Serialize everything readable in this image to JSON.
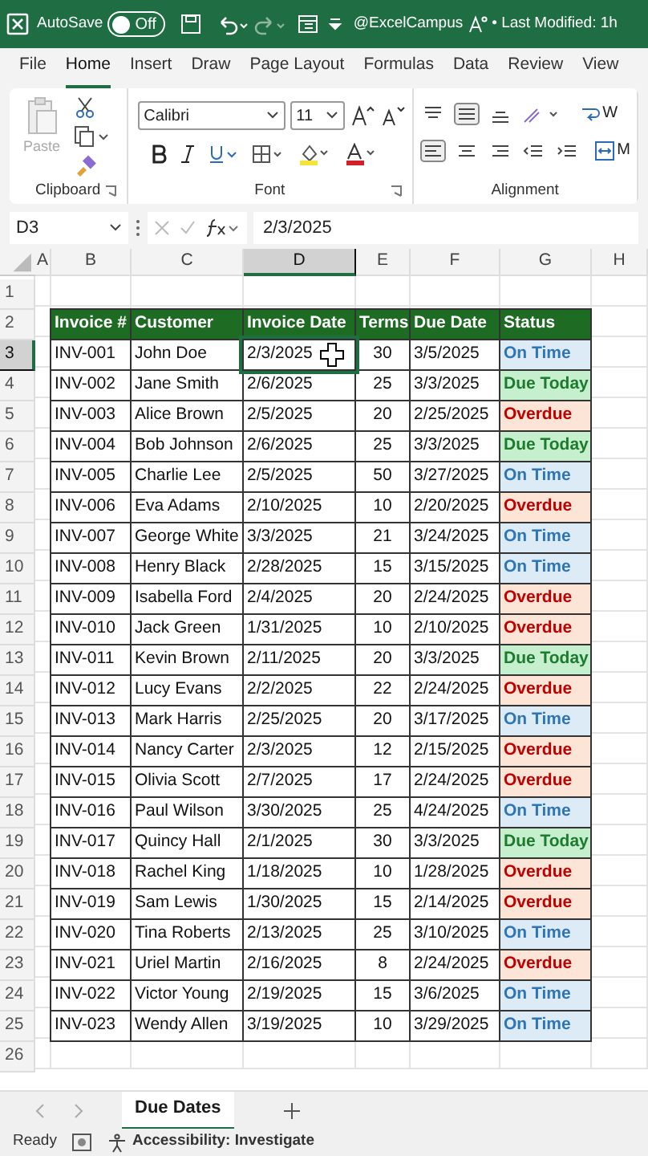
{
  "title_bar": {
    "autosave_label": "AutoSave",
    "autosave": {
      "on": false,
      "label": "Off"
    },
    "account": "@ExcelCampus",
    "modified": "• Last Modified: 1h"
  },
  "menu_tabs": [
    {
      "label": "File",
      "selected": false
    },
    {
      "label": "Home",
      "selected": true
    },
    {
      "label": "Insert",
      "selected": false
    },
    {
      "label": "Draw",
      "selected": false
    },
    {
      "label": "Page Layout",
      "selected": false
    },
    {
      "label": "Formulas",
      "selected": false
    },
    {
      "label": "Data",
      "selected": false
    },
    {
      "label": "Review",
      "selected": false
    },
    {
      "label": "View",
      "selected": false
    }
  ],
  "ribbon": {
    "paste_label": "Paste",
    "font_name": "Calibri",
    "font_size": "11",
    "wrap_text": "W",
    "merge": "M",
    "groups": [
      "Clipboard",
      "Font",
      "Alignment"
    ]
  },
  "formula_bar": {
    "name_box": "D3",
    "formula": "2/3/2025"
  },
  "columns": [
    {
      "label": "A",
      "selected": false
    },
    {
      "label": "B",
      "selected": false
    },
    {
      "label": "C",
      "selected": false
    },
    {
      "label": "D",
      "selected": true
    },
    {
      "label": "E",
      "selected": false
    },
    {
      "label": "F",
      "selected": false
    },
    {
      "label": "G",
      "selected": false
    },
    {
      "label": "H",
      "selected": false
    }
  ],
  "row_numbers": [
    {
      "label": "1",
      "selected": false
    },
    {
      "label": "2",
      "selected": false
    },
    {
      "label": "3",
      "selected": true
    },
    {
      "label": "4",
      "selected": false
    },
    {
      "label": "5",
      "selected": false
    },
    {
      "label": "6",
      "selected": false
    },
    {
      "label": "7",
      "selected": false
    },
    {
      "label": "8",
      "selected": false
    },
    {
      "label": "9",
      "selected": false
    },
    {
      "label": "10",
      "selected": false
    },
    {
      "label": "11",
      "selected": false
    },
    {
      "label": "12",
      "selected": false
    },
    {
      "label": "13",
      "selected": false
    },
    {
      "label": "14",
      "selected": false
    },
    {
      "label": "15",
      "selected": false
    },
    {
      "label": "16",
      "selected": false
    },
    {
      "label": "17",
      "selected": false
    },
    {
      "label": "18",
      "selected": false
    },
    {
      "label": "19",
      "selected": false
    },
    {
      "label": "20",
      "selected": false
    },
    {
      "label": "21",
      "selected": false
    },
    {
      "label": "22",
      "selected": false
    },
    {
      "label": "23",
      "selected": false
    },
    {
      "label": "24",
      "selected": false
    },
    {
      "label": "25",
      "selected": false
    },
    {
      "label": "26",
      "selected": false
    }
  ],
  "table": {
    "headers": [
      "Invoice #",
      "Customer",
      "Invoice Date",
      "Terms",
      "Due Date",
      "Status"
    ],
    "rows": [
      {
        "invoice": "INV-001",
        "customer": "John Doe",
        "invoice_date": "2/3/2025",
        "terms": "30",
        "due_date": "3/5/2025",
        "status": "On Time",
        "kind": "on_time",
        "selected": true
      },
      {
        "invoice": "INV-002",
        "customer": "Jane Smith",
        "invoice_date": "2/6/2025",
        "terms": "25",
        "due_date": "3/3/2025",
        "status": "Due Today",
        "kind": "due_today",
        "selected": false
      },
      {
        "invoice": "INV-003",
        "customer": "Alice Brown",
        "invoice_date": "2/5/2025",
        "terms": "20",
        "due_date": "2/25/2025",
        "status": "Overdue",
        "kind": "overdue",
        "selected": false
      },
      {
        "invoice": "INV-004",
        "customer": "Bob Johnson",
        "invoice_date": "2/6/2025",
        "terms": "25",
        "due_date": "3/3/2025",
        "status": "Due Today",
        "kind": "due_today",
        "selected": false
      },
      {
        "invoice": "INV-005",
        "customer": "Charlie Lee",
        "invoice_date": "2/5/2025",
        "terms": "50",
        "due_date": "3/27/2025",
        "status": "On Time",
        "kind": "on_time",
        "selected": false
      },
      {
        "invoice": "INV-006",
        "customer": "Eva Adams",
        "invoice_date": "2/10/2025",
        "terms": "10",
        "due_date": "2/20/2025",
        "status": "Overdue",
        "kind": "overdue",
        "selected": false
      },
      {
        "invoice": "INV-007",
        "customer": "George White",
        "invoice_date": "3/3/2025",
        "terms": "21",
        "due_date": "3/24/2025",
        "status": "On Time",
        "kind": "on_time",
        "selected": false
      },
      {
        "invoice": "INV-008",
        "customer": "Henry Black",
        "invoice_date": "2/28/2025",
        "terms": "15",
        "due_date": "3/15/2025",
        "status": "On Time",
        "kind": "on_time",
        "selected": false
      },
      {
        "invoice": "INV-009",
        "customer": "Isabella Ford",
        "invoice_date": "2/4/2025",
        "terms": "20",
        "due_date": "2/24/2025",
        "status": "Overdue",
        "kind": "overdue",
        "selected": false
      },
      {
        "invoice": "INV-010",
        "customer": "Jack Green",
        "invoice_date": "1/31/2025",
        "terms": "10",
        "due_date": "2/10/2025",
        "status": "Overdue",
        "kind": "overdue",
        "selected": false
      },
      {
        "invoice": "INV-011",
        "customer": "Kevin Brown",
        "invoice_date": "2/11/2025",
        "terms": "20",
        "due_date": "3/3/2025",
        "status": "Due Today",
        "kind": "due_today",
        "selected": false
      },
      {
        "invoice": "INV-012",
        "customer": "Lucy Evans",
        "invoice_date": "2/2/2025",
        "terms": "22",
        "due_date": "2/24/2025",
        "status": "Overdue",
        "kind": "overdue",
        "selected": false
      },
      {
        "invoice": "INV-013",
        "customer": "Mark Harris",
        "invoice_date": "2/25/2025",
        "terms": "20",
        "due_date": "3/17/2025",
        "status": "On Time",
        "kind": "on_time",
        "selected": false
      },
      {
        "invoice": "INV-014",
        "customer": "Nancy Carter",
        "invoice_date": "2/3/2025",
        "terms": "12",
        "due_date": "2/15/2025",
        "status": "Overdue",
        "kind": "overdue",
        "selected": false
      },
      {
        "invoice": "INV-015",
        "customer": "Olivia Scott",
        "invoice_date": "2/7/2025",
        "terms": "17",
        "due_date": "2/24/2025",
        "status": "Overdue",
        "kind": "overdue",
        "selected": false
      },
      {
        "invoice": "INV-016",
        "customer": "Paul Wilson",
        "invoice_date": "3/30/2025",
        "terms": "25",
        "due_date": "4/24/2025",
        "status": "On Time",
        "kind": "on_time",
        "selected": false
      },
      {
        "invoice": "INV-017",
        "customer": "Quincy Hall",
        "invoice_date": "2/1/2025",
        "terms": "30",
        "due_date": "3/3/2025",
        "status": "Due Today",
        "kind": "due_today",
        "selected": false
      },
      {
        "invoice": "INV-018",
        "customer": "Rachel King",
        "invoice_date": "1/18/2025",
        "terms": "10",
        "due_date": "1/28/2025",
        "status": "Overdue",
        "kind": "overdue",
        "selected": false
      },
      {
        "invoice": "INV-019",
        "customer": "Sam Lewis",
        "invoice_date": "1/30/2025",
        "terms": "15",
        "due_date": "2/14/2025",
        "status": "Overdue",
        "kind": "overdue",
        "selected": false
      },
      {
        "invoice": "INV-020",
        "customer": "Tina Roberts",
        "invoice_date": "2/13/2025",
        "terms": "25",
        "due_date": "3/10/2025",
        "status": "On Time",
        "kind": "on_time",
        "selected": false
      },
      {
        "invoice": "INV-021",
        "customer": "Uriel Martin",
        "invoice_date": "2/16/2025",
        "terms": "8",
        "due_date": "2/24/2025",
        "status": "Overdue",
        "kind": "overdue",
        "selected": false
      },
      {
        "invoice": "INV-022",
        "customer": "Victor Young",
        "invoice_date": "2/19/2025",
        "terms": "15",
        "due_date": "3/6/2025",
        "status": "On Time",
        "kind": "on_time",
        "selected": false
      },
      {
        "invoice": "INV-023",
        "customer": "Wendy Allen",
        "invoice_date": "3/19/2025",
        "terms": "10",
        "due_date": "3/29/2025",
        "status": "On Time",
        "kind": "on_time",
        "selected": false
      }
    ]
  },
  "sheet_tabs": [
    {
      "label": "Due Dates",
      "selected": true
    }
  ],
  "status_bar": {
    "ready": "Ready",
    "accessibility": "Accessibility: Investigate"
  }
}
